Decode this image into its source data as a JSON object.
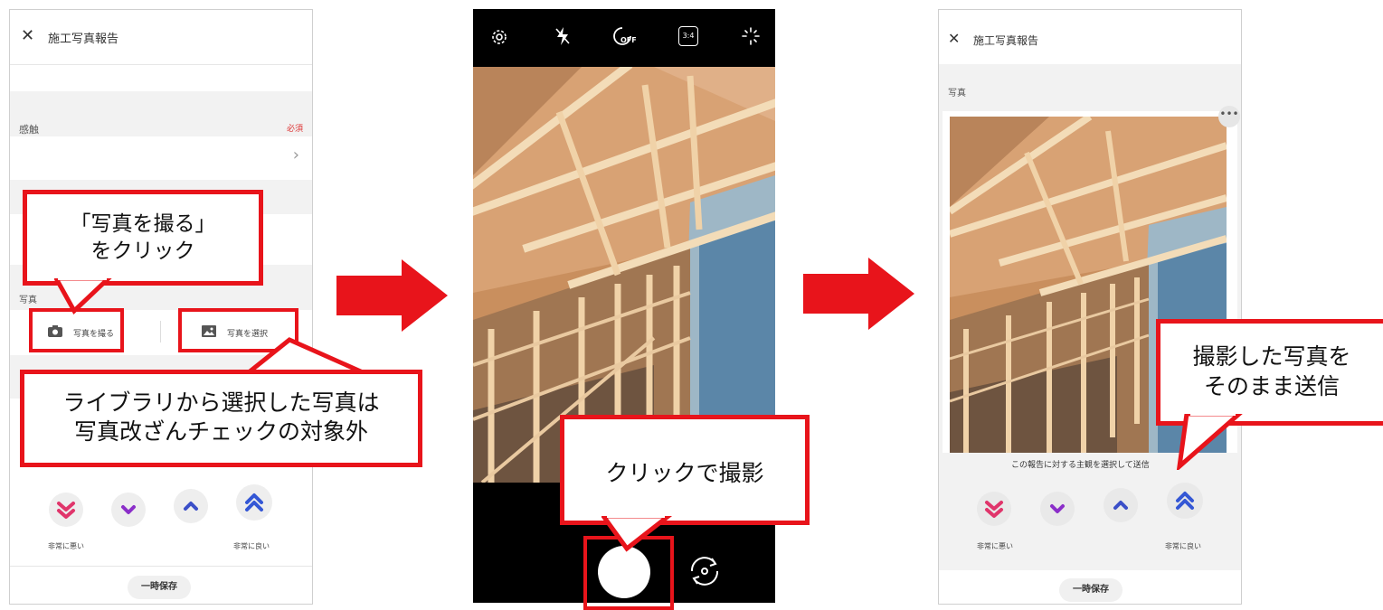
{
  "left": {
    "header_title": "施工写真報告",
    "section_label": "感触",
    "required_label": "必須",
    "photo_label": "写真",
    "take_photo_label": "写真を撮る",
    "select_photo_label": "写真を選択",
    "very_bad_label": "非常に悪い",
    "very_good_label": "非常に良い",
    "save_label": "一時保存",
    "callout_take": [
      "「写真を撮る」",
      "をクリック"
    ],
    "callout_library": [
      "ライブラリから選択した写真は",
      "写真改ざんチェックの対象外"
    ]
  },
  "middle": {
    "toolbar_icons": [
      "settings-icon",
      "flash-off-icon",
      "timer-off-icon",
      "ratio-icon",
      "sparkle-icon"
    ],
    "ratio_label": "3:4",
    "timer_label": "OFF",
    "callout_shoot": "クリックで撮影"
  },
  "right": {
    "header_title": "施工写真報告",
    "photo_label": "写真",
    "prompt_text": "この報告に対する主観を選択して送信",
    "very_bad_label": "非常に悪い",
    "very_good_label": "非常に良い",
    "save_label": "一時保存",
    "callout_send": [
      "撮影した写真を",
      "そのまま送信"
    ]
  },
  "colors": {
    "arrow_red": "#e8141b",
    "very_bad": "#e0356b",
    "bad": "#8b2fc9",
    "good": "#3b4fc8",
    "very_good": "#3457d5"
  }
}
